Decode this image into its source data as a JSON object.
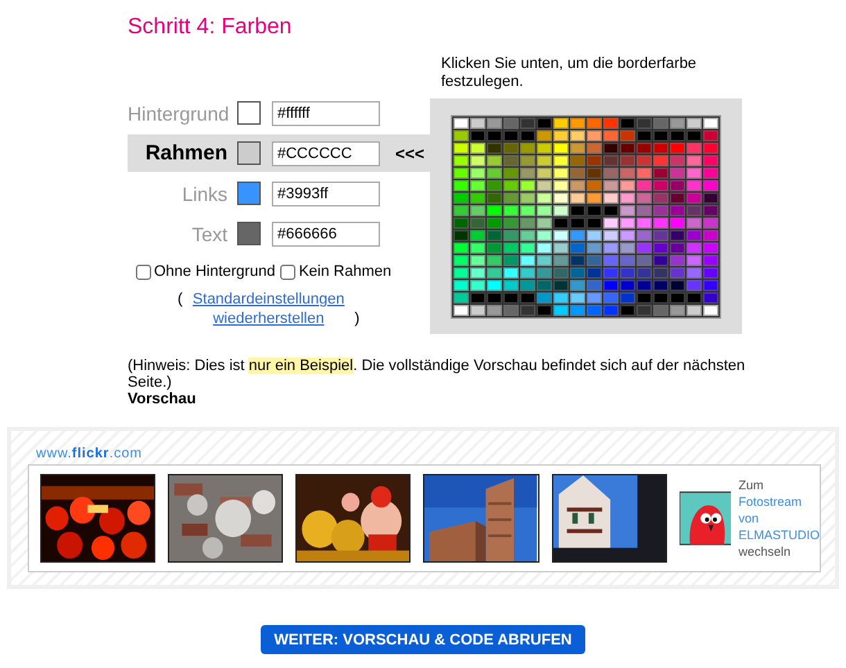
{
  "title": "Schritt 4: Farben",
  "color_fields": [
    {
      "label": "Hintergrund",
      "color": "#ffffff",
      "value": "#ffffff",
      "selected": false
    },
    {
      "label": "Rahmen",
      "color": "#cccccc",
      "value": "#CCCCCC",
      "selected": true
    },
    {
      "label": "Links",
      "color": "#3993ff",
      "value": "#3993ff",
      "selected": false
    },
    {
      "label": "Text",
      "color": "#666666",
      "value": "#666666",
      "selected": false
    }
  ],
  "selection_pointer": "<<<",
  "checkboxes": [
    {
      "label": "Ohne Hintergrund",
      "checked": false
    },
    {
      "label": "Kein Rahmen",
      "checked": false
    }
  ],
  "reset": {
    "before": "(",
    "link": "Standardeinstellungen wiederherstellen",
    "after": ")"
  },
  "palette_instruction": "Klicken Sie unten, um die borderfarbe festzulegen.",
  "palette": [
    [
      {
        "color": "#ffffff"
      },
      {
        "color": "#cccccc"
      },
      {
        "color": "#999999"
      },
      {
        "color": "#666666"
      },
      {
        "color": "#333333"
      },
      {
        "color": "#000000"
      },
      {
        "color": "#ffcc00"
      },
      {
        "color": "#ff9900"
      },
      {
        "color": "#ff6600"
      },
      {
        "color": "#ff3300"
      },
      {
        "color": "#000000"
      },
      {
        "color": "#333333"
      },
      {
        "color": "#666666"
      },
      {
        "color": "#999999"
      },
      {
        "color": "#cccccc"
      },
      {
        "color": "#ffffff"
      }
    ],
    [
      {
        "color": "#99cc00"
      },
      {
        "color": "#000000"
      },
      {
        "color": "#000000"
      },
      {
        "color": "#000000"
      },
      {
        "color": "#000000"
      },
      {
        "color": "#cc9900"
      },
      {
        "color": "#ffcc33"
      },
      {
        "color": "#ffcc66"
      },
      {
        "color": "#ff9966"
      },
      {
        "color": "#ff6633"
      },
      {
        "color": "#cc3300"
      },
      {
        "color": "#000000"
      },
      {
        "color": "#000000"
      },
      {
        "color": "#000000"
      },
      {
        "color": "#000000"
      },
      {
        "color": "#cc0033"
      }
    ],
    [
      {
        "color": "#ccff00"
      },
      {
        "color": "#ccff33"
      },
      {
        "color": "#333300"
      },
      {
        "color": "#666600"
      },
      {
        "color": "#999900"
      },
      {
        "color": "#cccc00"
      },
      {
        "color": "#ffff00"
      },
      {
        "color": "#cc9933"
      },
      {
        "color": "#cc6633"
      },
      {
        "color": "#330000"
      },
      {
        "color": "#660000"
      },
      {
        "color": "#990000"
      },
      {
        "color": "#cc0000"
      },
      {
        "color": "#ff0000"
      },
      {
        "color": "#ff3366"
      },
      {
        "color": "#ff0033"
      }
    ],
    [
      {
        "color": "#99ff00"
      },
      {
        "color": "#ccff66"
      },
      {
        "color": "#99cc33"
      },
      {
        "color": "#666633"
      },
      {
        "color": "#999933"
      },
      {
        "color": "#cccc33"
      },
      {
        "color": "#ffff33"
      },
      {
        "color": "#996600"
      },
      {
        "color": "#993300"
      },
      {
        "color": "#663333"
      },
      {
        "color": "#993333"
      },
      {
        "color": "#cc3333"
      },
      {
        "color": "#ff3333"
      },
      {
        "color": "#cc3366"
      },
      {
        "color": "#ff6699"
      },
      {
        "color": "#ff0066"
      }
    ],
    [
      {
        "color": "#66ff00"
      },
      {
        "color": "#99ff66"
      },
      {
        "color": "#66cc33"
      },
      {
        "color": "#669900"
      },
      {
        "color": "#999966"
      },
      {
        "color": "#cccc66"
      },
      {
        "color": "#ffff66"
      },
      {
        "color": "#996633"
      },
      {
        "color": "#663300"
      },
      {
        "color": "#996666"
      },
      {
        "color": "#cc6666"
      },
      {
        "color": "#ff6666"
      },
      {
        "color": "#990033"
      },
      {
        "color": "#cc3399"
      },
      {
        "color": "#ff66cc"
      },
      {
        "color": "#ff0099"
      }
    ],
    [
      {
        "color": "#33ff00"
      },
      {
        "color": "#66ff33"
      },
      {
        "color": "#339900"
      },
      {
        "color": "#66cc00"
      },
      {
        "color": "#99ff33"
      },
      {
        "color": "#cccc99"
      },
      {
        "color": "#ffff99"
      },
      {
        "color": "#cc9966"
      },
      {
        "color": "#cc6600"
      },
      {
        "color": "#cc9999"
      },
      {
        "color": "#ff9999"
      },
      {
        "color": "#ff3399"
      },
      {
        "color": "#cc0066"
      },
      {
        "color": "#990066"
      },
      {
        "color": "#ff33cc"
      },
      {
        "color": "#ff00cc"
      }
    ],
    [
      {
        "color": "#00cc00"
      },
      {
        "color": "#33cc00"
      },
      {
        "color": "#336600"
      },
      {
        "color": "#669933"
      },
      {
        "color": "#99cc66"
      },
      {
        "color": "#ccff99"
      },
      {
        "color": "#ffffcc"
      },
      {
        "color": "#ffcc99"
      },
      {
        "color": "#ff9933"
      },
      {
        "color": "#ffcccc"
      },
      {
        "color": "#ff99cc"
      },
      {
        "color": "#cc6699"
      },
      {
        "color": "#993366"
      },
      {
        "color": "#660033"
      },
      {
        "color": "#cc0099"
      },
      {
        "color": "#330033"
      }
    ],
    [
      {
        "color": "#33cc33"
      },
      {
        "color": "#66cc66"
      },
      {
        "color": "#00ff00"
      },
      {
        "color": "#33ff33"
      },
      {
        "color": "#66ff66"
      },
      {
        "color": "#99ff99"
      },
      {
        "color": "#ccffcc"
      },
      {
        "color": "#000000"
      },
      {
        "color": "#000000"
      },
      {
        "color": "#000000"
      },
      {
        "color": "#cc99cc"
      },
      {
        "color": "#996699"
      },
      {
        "color": "#993399"
      },
      {
        "color": "#990099"
      },
      {
        "color": "#663366"
      },
      {
        "color": "#660066"
      }
    ],
    [
      {
        "color": "#006600"
      },
      {
        "color": "#336633"
      },
      {
        "color": "#009900"
      },
      {
        "color": "#339933"
      },
      {
        "color": "#669966"
      },
      {
        "color": "#99cc99"
      },
      {
        "color": "#000000"
      },
      {
        "color": "#000000"
      },
      {
        "color": "#000000"
      },
      {
        "color": "#ffccff"
      },
      {
        "color": "#ff99ff"
      },
      {
        "color": "#ff66ff"
      },
      {
        "color": "#ff33ff"
      },
      {
        "color": "#ff00ff"
      },
      {
        "color": "#cc66cc"
      },
      {
        "color": "#cc33cc"
      }
    ],
    [
      {
        "color": "#003300"
      },
      {
        "color": "#00cc33"
      },
      {
        "color": "#006633"
      },
      {
        "color": "#339966"
      },
      {
        "color": "#66cc99"
      },
      {
        "color": "#99ffcc"
      },
      {
        "color": "#ccffff"
      },
      {
        "color": "#3399ff"
      },
      {
        "color": "#99ccff"
      },
      {
        "color": "#ccccff"
      },
      {
        "color": "#cc99ff"
      },
      {
        "color": "#9966cc"
      },
      {
        "color": "#663399"
      },
      {
        "color": "#330066"
      },
      {
        "color": "#9900cc"
      },
      {
        "color": "#cc00cc"
      }
    ],
    [
      {
        "color": "#00ff33"
      },
      {
        "color": "#33ff66"
      },
      {
        "color": "#009933"
      },
      {
        "color": "#00cc66"
      },
      {
        "color": "#33ff99"
      },
      {
        "color": "#99ffff"
      },
      {
        "color": "#99cccc"
      },
      {
        "color": "#0066cc"
      },
      {
        "color": "#6699cc"
      },
      {
        "color": "#9999ff"
      },
      {
        "color": "#9999cc"
      },
      {
        "color": "#9933ff"
      },
      {
        "color": "#6600cc"
      },
      {
        "color": "#660099"
      },
      {
        "color": "#cc33ff"
      },
      {
        "color": "#cc00ff"
      }
    ],
    [
      {
        "color": "#00ff66"
      },
      {
        "color": "#66ff99"
      },
      {
        "color": "#33cc66"
      },
      {
        "color": "#009966"
      },
      {
        "color": "#66ffff"
      },
      {
        "color": "#66cccc"
      },
      {
        "color": "#669999"
      },
      {
        "color": "#003366"
      },
      {
        "color": "#336699"
      },
      {
        "color": "#6666ff"
      },
      {
        "color": "#6666cc"
      },
      {
        "color": "#666699"
      },
      {
        "color": "#330099"
      },
      {
        "color": "#9933cc"
      },
      {
        "color": "#cc66ff"
      },
      {
        "color": "#9900ff"
      }
    ],
    [
      {
        "color": "#00ff99"
      },
      {
        "color": "#66ffcc"
      },
      {
        "color": "#33cc99"
      },
      {
        "color": "#33ffff"
      },
      {
        "color": "#33cccc"
      },
      {
        "color": "#339999"
      },
      {
        "color": "#336666"
      },
      {
        "color": "#006699"
      },
      {
        "color": "#003399"
      },
      {
        "color": "#3333ff"
      },
      {
        "color": "#3333cc"
      },
      {
        "color": "#333399"
      },
      {
        "color": "#333366"
      },
      {
        "color": "#6633cc"
      },
      {
        "color": "#9966ff"
      },
      {
        "color": "#6600ff"
      }
    ],
    [
      {
        "color": "#00ffcc"
      },
      {
        "color": "#33ffcc"
      },
      {
        "color": "#00ffff"
      },
      {
        "color": "#00cccc"
      },
      {
        "color": "#009999"
      },
      {
        "color": "#006666"
      },
      {
        "color": "#003333"
      },
      {
        "color": "#3399cc"
      },
      {
        "color": "#3366cc"
      },
      {
        "color": "#0000ff"
      },
      {
        "color": "#0000cc"
      },
      {
        "color": "#000099"
      },
      {
        "color": "#000066"
      },
      {
        "color": "#000033"
      },
      {
        "color": "#6633ff"
      },
      {
        "color": "#3300ff"
      }
    ],
    [
      {
        "color": "#00cc99"
      },
      {
        "color": "#000000"
      },
      {
        "color": "#000000"
      },
      {
        "color": "#000000"
      },
      {
        "color": "#000000"
      },
      {
        "color": "#0099cc"
      },
      {
        "color": "#33ccff"
      },
      {
        "color": "#66ccff"
      },
      {
        "color": "#6699ff"
      },
      {
        "color": "#3366ff"
      },
      {
        "color": "#0033cc"
      },
      {
        "color": "#000000"
      },
      {
        "color": "#000000"
      },
      {
        "color": "#000000"
      },
      {
        "color": "#000000"
      },
      {
        "color": "#3300cc"
      }
    ],
    [
      {
        "color": "#ffffff"
      },
      {
        "color": "#cccccc"
      },
      {
        "color": "#999999"
      },
      {
        "color": "#666666"
      },
      {
        "color": "#333333"
      },
      {
        "color": "#000000"
      },
      {
        "color": "#00ccff"
      },
      {
        "color": "#0099ff"
      },
      {
        "color": "#0066ff"
      },
      {
        "color": "#0033ff"
      },
      {
        "color": "#000000"
      },
      {
        "color": "#333333"
      },
      {
        "color": "#666666"
      },
      {
        "color": "#999999"
      },
      {
        "color": "#cccccc"
      },
      {
        "color": "#ffffff"
      }
    ]
  ],
  "hint": {
    "before": "(Hinweis: Dies ist ",
    "highlight": "nur ein Beispiel",
    "after": ". Die vollständige Vorschau befindet sich auf der nächsten Seite.)"
  },
  "preview_heading": "Vorschau",
  "preview": {
    "site_label": "www.**flickr**.com",
    "stream": {
      "before": "Zum",
      "link": "Fotostream von ELMASTUDIO",
      "after": "wechseln"
    }
  },
  "button": "WEITER: VORSCHAU & CODE ABRUFEN"
}
